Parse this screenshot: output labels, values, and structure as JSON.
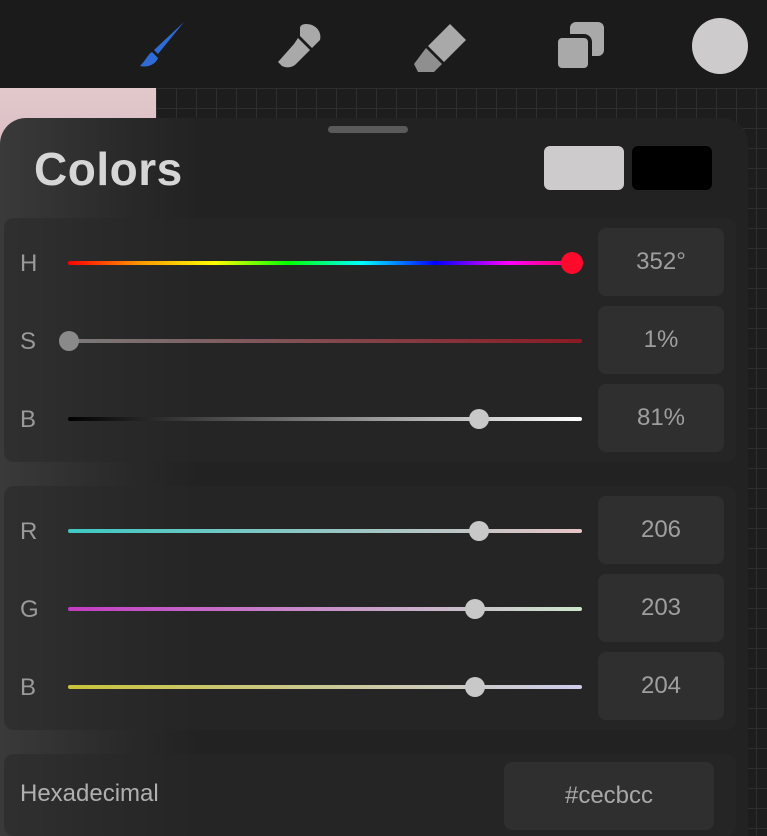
{
  "panel": {
    "title": "Colors",
    "primary_color": "#cecbcc",
    "secondary_color": "#000000"
  },
  "toolbar": {
    "active_tool_color": "#2f6bd6",
    "tool_color": "#a9a9a9",
    "tools": [
      "brush-icon",
      "smudge-icon",
      "eraser-icon",
      "layers-icon",
      "color-icon"
    ]
  },
  "hsb": {
    "h_label": "H",
    "h_value": "352°",
    "h_position": 0.988,
    "s_label": "S",
    "s_value": "1%",
    "s_position": 0.01,
    "b_label": "B",
    "b_value": "81%",
    "b_position": 0.81
  },
  "rgb": {
    "r_label": "R",
    "r_value": "206",
    "r_position": 0.808,
    "g_label": "G",
    "g_value": "203",
    "g_position": 0.796,
    "b_label": "B",
    "b_value": "204",
    "b_position": 0.8
  },
  "hex": {
    "label": "Hexadecimal",
    "value": "#cecbcc"
  }
}
